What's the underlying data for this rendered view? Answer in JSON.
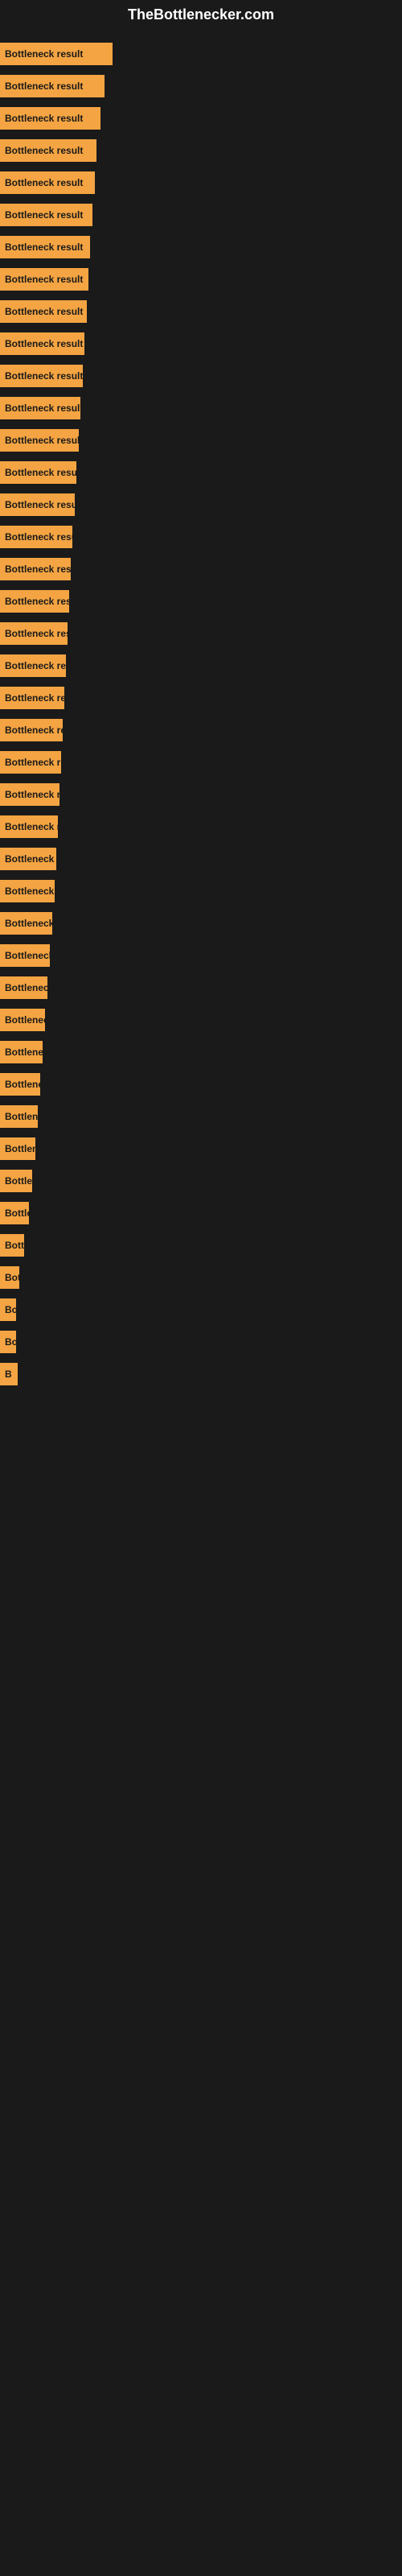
{
  "site": {
    "title": "TheBottlenecker.com"
  },
  "bars": [
    {
      "label": "Bottleneck result",
      "width": 140
    },
    {
      "label": "Bottleneck result",
      "width": 130
    },
    {
      "label": "Bottleneck result",
      "width": 125
    },
    {
      "label": "Bottleneck result",
      "width": 120
    },
    {
      "label": "Bottleneck result",
      "width": 118
    },
    {
      "label": "Bottleneck result",
      "width": 115
    },
    {
      "label": "Bottleneck result",
      "width": 112
    },
    {
      "label": "Bottleneck result",
      "width": 110
    },
    {
      "label": "Bottleneck result",
      "width": 108
    },
    {
      "label": "Bottleneck result",
      "width": 105
    },
    {
      "label": "Bottleneck result",
      "width": 103
    },
    {
      "label": "Bottleneck result",
      "width": 100
    },
    {
      "label": "Bottleneck result",
      "width": 98
    },
    {
      "label": "Bottleneck result",
      "width": 95
    },
    {
      "label": "Bottleneck result",
      "width": 93
    },
    {
      "label": "Bottleneck result",
      "width": 90
    },
    {
      "label": "Bottleneck result",
      "width": 88
    },
    {
      "label": "Bottleneck result",
      "width": 86
    },
    {
      "label": "Bottleneck result",
      "width": 84
    },
    {
      "label": "Bottleneck result",
      "width": 82
    },
    {
      "label": "Bottleneck result",
      "width": 80
    },
    {
      "label": "Bottleneck result",
      "width": 78
    },
    {
      "label": "Bottleneck result",
      "width": 76
    },
    {
      "label": "Bottleneck result",
      "width": 74
    },
    {
      "label": "Bottleneck result",
      "width": 72
    },
    {
      "label": "Bottleneck result",
      "width": 70
    },
    {
      "label": "Bottleneck result",
      "width": 68
    },
    {
      "label": "Bottleneck result",
      "width": 65
    },
    {
      "label": "Bottleneck result",
      "width": 62
    },
    {
      "label": "Bottleneck result",
      "width": 59
    },
    {
      "label": "Bottleneck result",
      "width": 56
    },
    {
      "label": "Bottleneck result",
      "width": 53
    },
    {
      "label": "Bottleneck result",
      "width": 50
    },
    {
      "label": "Bottleneck result",
      "width": 47
    },
    {
      "label": "Bottleneck result",
      "width": 44
    },
    {
      "label": "Bottleneck result",
      "width": 40
    },
    {
      "label": "Bottleneck result",
      "width": 36
    },
    {
      "label": "Bottleneck result",
      "width": 30
    },
    {
      "label": "Bottleneck result",
      "width": 24
    },
    {
      "label": "Bottleneck result",
      "width": 18
    },
    {
      "label": "Bottleneck result",
      "width": 12
    },
    {
      "label": "B",
      "width": 22
    }
  ]
}
